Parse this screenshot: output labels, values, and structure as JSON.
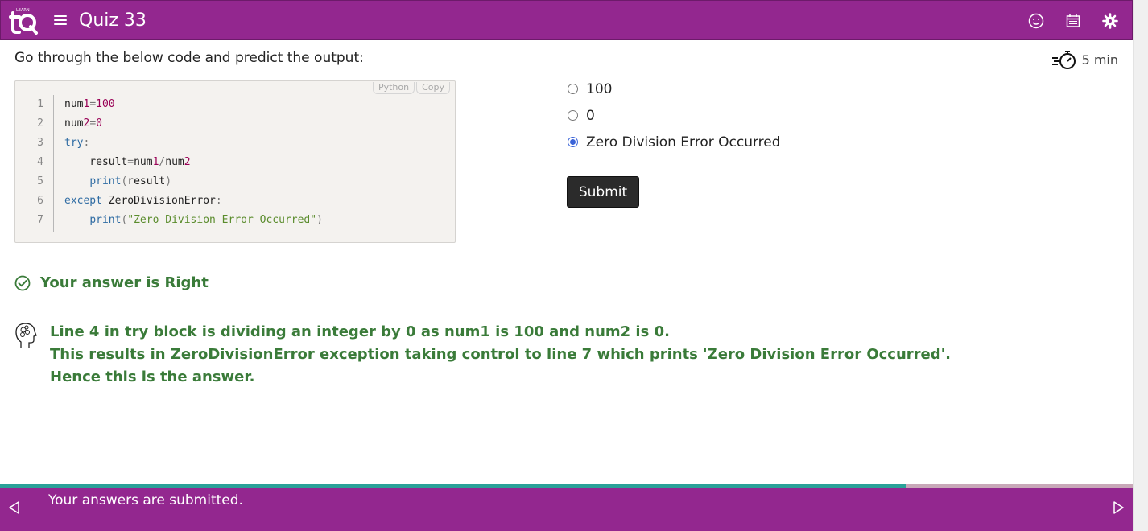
{
  "header": {
    "title": "Quiz 33",
    "logo_text": "LEARN",
    "icons": [
      "smiley-icon",
      "calendar-icon",
      "gear-icon"
    ],
    "color": "#93278f"
  },
  "question": {
    "prompt": "Go through the below code and predict the output:",
    "timer": "5 min"
  },
  "code": {
    "language_tag": "Python",
    "copy_label": "Copy",
    "line_numbers": [
      "1",
      "2",
      "3",
      "4",
      "5",
      "6",
      "7"
    ],
    "lines": [
      "num1=100",
      "num2=0",
      "try:",
      "    result=num1/num2",
      "    print(result)",
      "except ZeroDivisionError:",
      "    print(\"Zero Division Error Occurred\")"
    ]
  },
  "options": {
    "items": [
      {
        "label": "100",
        "selected": false
      },
      {
        "label": "0",
        "selected": false
      },
      {
        "label": "Zero Division Error Occurred",
        "selected": true
      }
    ],
    "submit_label": "Submit"
  },
  "feedback": {
    "result": "Your answer is Right",
    "explanation": [
      "Line 4 in try block is dividing an integer by 0 as num1 is 100 and num2 is 0.",
      "This results in ZeroDivisionError exception taking control to line 7 which prints 'Zero Division Error Occurred'.",
      "Hence this is the answer."
    ],
    "color": "#3a7b39"
  },
  "footer": {
    "message": "Your answers are submitted.",
    "progress": 0.8,
    "progress_color": "#2aa198"
  }
}
